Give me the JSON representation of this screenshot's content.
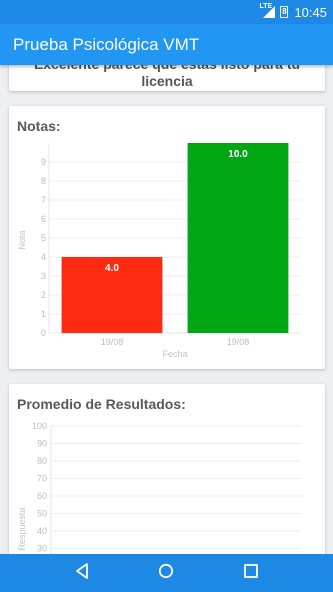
{
  "status_bar": {
    "network": "LTE",
    "battery": "8",
    "time": "10:45"
  },
  "app_bar": {
    "title": "Prueba Psicológica VMT"
  },
  "result_card": {
    "line1": "Excelente parece que estás listo para tu",
    "line2": "licencia"
  },
  "notas_card": {
    "title": "Notas:"
  },
  "promedio_card": {
    "title": "Promedio de Resultados:"
  },
  "chart_data": [
    {
      "type": "bar",
      "title": "Notas:",
      "categories": [
        "19/08",
        "19/08"
      ],
      "values": [
        4.0,
        10.0
      ],
      "value_labels": [
        "4.0",
        "10.0"
      ],
      "bar_colors": [
        "#ff2a12",
        "#00a712"
      ],
      "xlabel": "Fecha",
      "ylabel": "Nota",
      "yticks": [
        "0",
        "1",
        "2",
        "3",
        "4",
        "5",
        "6",
        "7",
        "8",
        "9"
      ],
      "ylim": [
        0,
        10
      ],
      "grid": true
    },
    {
      "type": "line",
      "title": "Promedio de Resultados:",
      "ylabel": "Respuesta",
      "yticks": [
        "30",
        "40",
        "50",
        "60",
        "70",
        "80",
        "90",
        "100"
      ],
      "ylim": [
        30,
        100
      ],
      "grid": true
    }
  ],
  "nav_bar": {
    "back": "back-icon",
    "home": "home-icon",
    "recents": "recents-icon"
  }
}
